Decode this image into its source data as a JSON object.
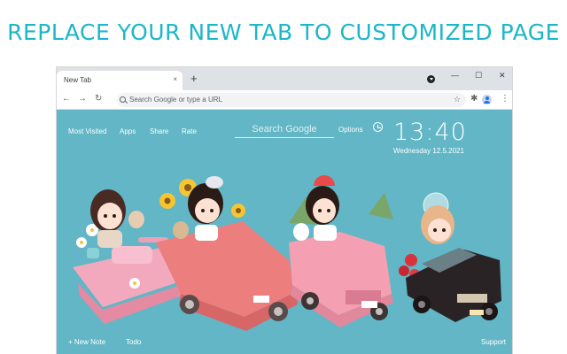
{
  "banner": {
    "headline": "REPLACE YOUR NEW TAB TO CUSTOMIZED PAGE"
  },
  "browser": {
    "tab": {
      "title": "New Tab",
      "close": "×"
    },
    "new_tab_symbol": "+",
    "window_controls": {
      "minimize": "—",
      "maximize": "☐",
      "close": "✕"
    },
    "toolbar": {
      "back": "←",
      "forward": "→",
      "reload": "↻",
      "omnibox_placeholder": "Search Google or type a URL",
      "bookmark_star": "☆",
      "extensions": "✱",
      "menu": "⋮"
    }
  },
  "page": {
    "nav": {
      "most_visited": "Most Visited",
      "apps": "Apps",
      "share": "Share",
      "rate": "Rate"
    },
    "search": {
      "placeholder": "Search Google"
    },
    "options": "Options",
    "clock": {
      "time": "13:40",
      "date": "Wednesday   12.5.2021"
    },
    "footer": {
      "new_note": "+ New Note",
      "todo": "Todo",
      "support": "Support"
    }
  },
  "colors": {
    "banner_text": "#1cb6c9",
    "page_bg": "#62b6c5",
    "chrome_tabstrip": "#dee1e6"
  }
}
